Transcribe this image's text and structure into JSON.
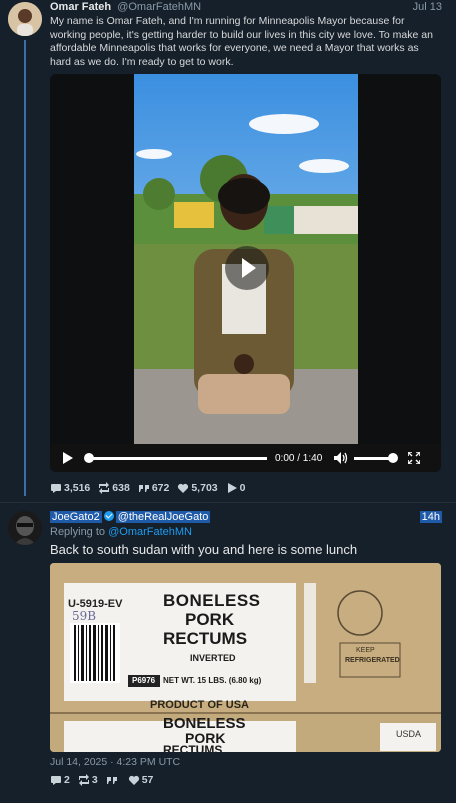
{
  "tweet1": {
    "name": "Omar Fateh",
    "handle": "@OmarFatehMN",
    "date": "Jul 13",
    "text": "My name is Omar Fateh, and I'm running for Minneapolis Mayor because for working people, it's getting harder to build our lives in this city we love. To make an affordable Minneapolis that works for everyone, we need a Mayor that works as hard as we do. I'm ready to get to work.",
    "video": {
      "time": "0:00 / 1:40",
      "progress": 0.0,
      "volume": 1.0
    },
    "stats": {
      "replies": "3,516",
      "retweets": "638",
      "quotes": "672",
      "likes": "5,703",
      "views": "0"
    }
  },
  "tweet2": {
    "name": "JoeGato2",
    "handle": "@theRealJoeGato",
    "date": "14h",
    "reply_prefix": "Replying to ",
    "reply_handle": "@OmarFatehMN",
    "text": "Back to south sudan with you and here is some lunch",
    "photo": {
      "box_code": "U-5919-EV",
      "handwritten": "59B",
      "line1": "BONELESS",
      "line2": "PORK",
      "line3": "RECTUMS",
      "inverted": "INVERTED",
      "lot": "P6976",
      "weight": "NET WT. 15 LBS. (6.80 kg)",
      "origin": "PRODUCT OF USA",
      "keep": "KEEP",
      "refrigerated": "REFRIGERATED",
      "usda": "USDA"
    },
    "timestamp": "Jul 14, 2025 · 4:23 PM UTC",
    "stats": {
      "replies": "2",
      "retweets": "3",
      "quotes": "",
      "likes": "57"
    }
  },
  "colors": {
    "background": "#15202b",
    "accent": "#1d9bf0",
    "highlight": "#1e5aa8"
  }
}
